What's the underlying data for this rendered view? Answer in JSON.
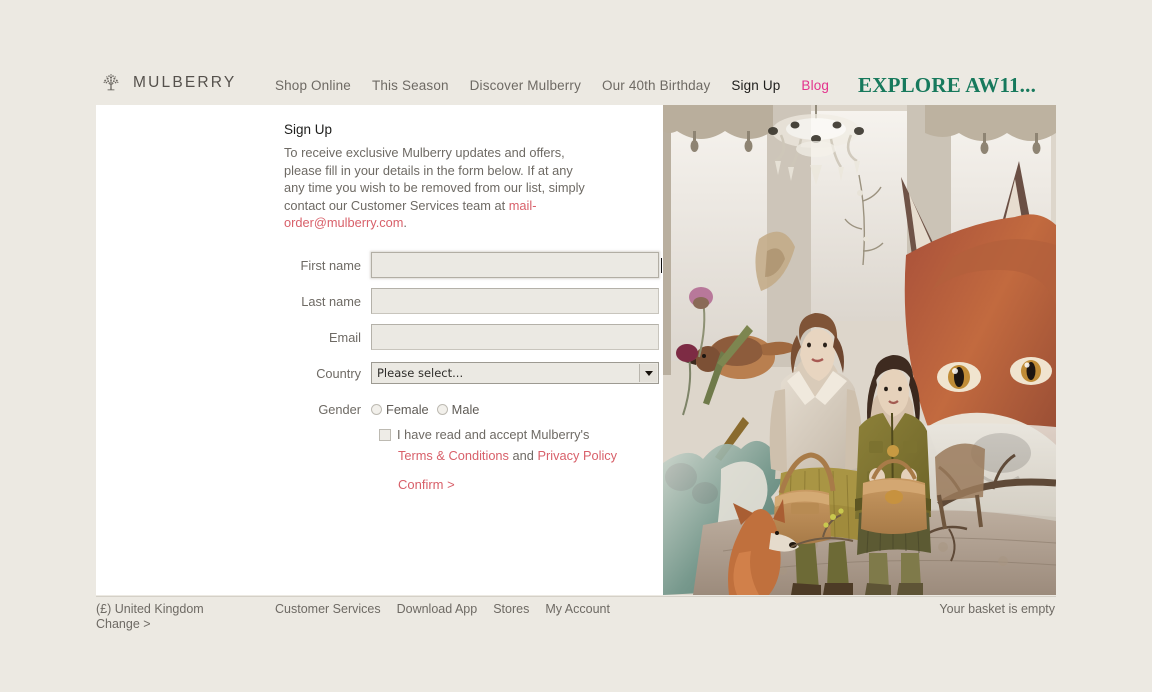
{
  "header": {
    "brand": {
      "name": "MULBERRY",
      "logo_icon": "mulberry-tree-icon"
    },
    "nav": [
      {
        "label": "Shop Online",
        "state": "normal"
      },
      {
        "label": "This Season",
        "state": "normal"
      },
      {
        "label": "Discover Mulberry",
        "state": "normal"
      },
      {
        "label": "Our 40th Birthday",
        "state": "normal"
      },
      {
        "label": "Sign Up",
        "state": "active"
      },
      {
        "label": "Blog",
        "state": "blog"
      }
    ],
    "promo": {
      "label": "EXPLORE AW11...",
      "color": "#17795c"
    }
  },
  "main": {
    "intro": {
      "title": "Sign Up",
      "body_before": "To receive exclusive Mulberry updates and offers, please fill in your details in the form below. If at any any time you wish to be removed from our list, simply contact our Customer Services team at ",
      "email_link": "mail-order@mulberry.com",
      "body_after": "."
    },
    "form": {
      "first_name": {
        "label": "First name",
        "value": "",
        "placeholder": "",
        "focused": true
      },
      "last_name": {
        "label": "Last name",
        "value": "",
        "placeholder": ""
      },
      "email": {
        "label": "Email",
        "value": "",
        "placeholder": ""
      },
      "country": {
        "label": "Country",
        "selected": "Please select...",
        "options": [
          "Please select..."
        ]
      },
      "gender": {
        "label": "Gender",
        "options": [
          {
            "label": "Female",
            "checked": false
          },
          {
            "label": "Male",
            "checked": false
          }
        ]
      }
    },
    "terms": {
      "checkbox_checked": false,
      "accept_text": "I have read and accept Mulberry's",
      "terms_link": "Terms & Conditions",
      "conjunction": "and",
      "privacy_link": "Privacy Policy",
      "confirm_label": "Confirm >",
      "link_color": "#d8606a"
    },
    "hero": {
      "alt": "Mulberry autumn winter campaign: two models with handbags beside a giant fox, chandelier and birds"
    }
  },
  "footer": {
    "region": "(£) United Kingdom",
    "change_label": "Change >",
    "links": [
      {
        "label": "Customer Services"
      },
      {
        "label": "Download App"
      },
      {
        "label": "Stores"
      },
      {
        "label": "My Account"
      }
    ],
    "basket_status": "Your basket is empty"
  },
  "colors": {
    "page_background": "#ece9e2",
    "panel_background": "#ffffff",
    "text_muted": "#6e6a64",
    "accent_rose": "#d8606a",
    "accent_green": "#17795c",
    "accent_pink": "#e3338d"
  }
}
